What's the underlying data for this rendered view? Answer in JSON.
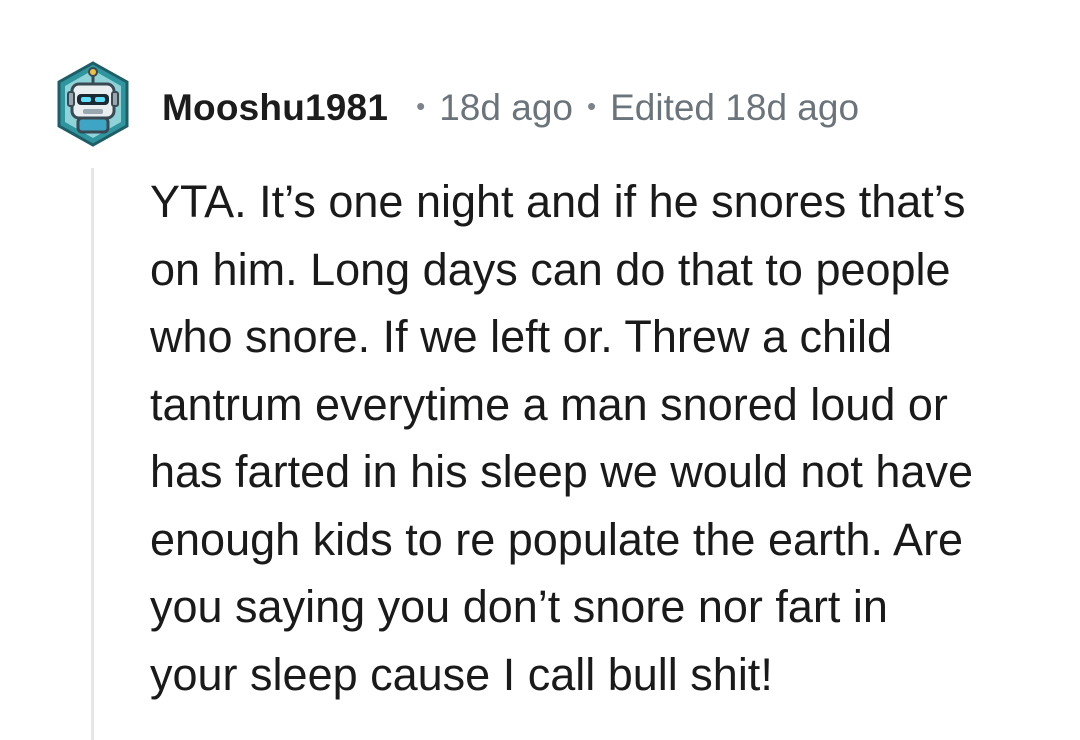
{
  "comment": {
    "username": "Mooshu1981",
    "separator": "•",
    "time_ago": "18d ago",
    "edited": "Edited 18d ago",
    "avatar_icon": "robot-avatar-icon",
    "body_lines": [
      "YTA. It’s one night and if he snores that’s",
      "on him. Long days can do that to people",
      "who snore. If we left or. Threw a child",
      "tantrum everytime a man snored loud or",
      "has farted in his sleep we would not have",
      "enough kids to re populate the earth. Are",
      "you saying you don’t snore nor fart in",
      "your sleep cause I call bull shit!"
    ]
  },
  "colors": {
    "text": "#1a1a1b",
    "meta": "#6b747a",
    "thread_line": "#e6e6e6",
    "avatar_bg": "#2c8f98"
  }
}
